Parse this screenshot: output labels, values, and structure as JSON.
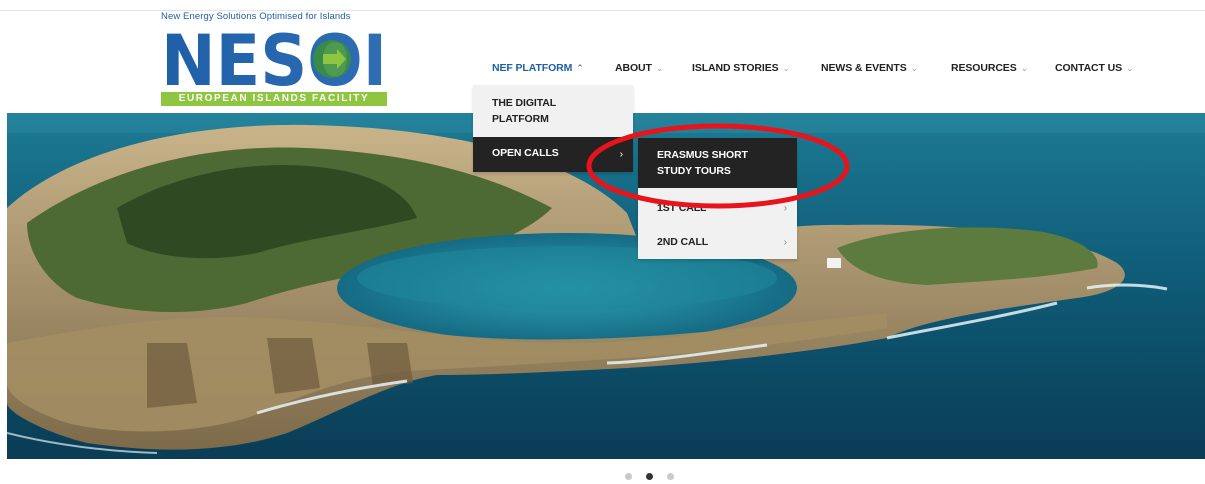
{
  "logo": {
    "tagline": "New Energy Solutions Optimised for Islands",
    "wordmark": "NESOI",
    "band": "EUROPEAN ISLANDS FACILITY",
    "colors": {
      "word": "#1e5fa8",
      "accent": "#3a8f3d",
      "band": "#8ec641"
    }
  },
  "nav": {
    "items": [
      {
        "label": "NEF PLATFORM",
        "active": true
      },
      {
        "label": "ABOUT"
      },
      {
        "label": "ISLAND STORIES"
      },
      {
        "label": "NEWS & EVENTS"
      },
      {
        "label": "RESOURCES"
      },
      {
        "label": "CONTACT US"
      }
    ],
    "caret_icon": "chevron-down-icon",
    "active_color": "#1e5fa8"
  },
  "dropdown": {
    "items": [
      {
        "label_line1": "THE DIGITAL",
        "label_line2": "PLATFORM"
      },
      {
        "label": "OPEN CALLS",
        "highlighted": true,
        "submenu_icon": "chevron-right-icon"
      }
    ]
  },
  "submenu": {
    "items": [
      {
        "label_line1": "ERASMUS SHORT",
        "label_line2": "STUDY TOURS",
        "highlighted": true
      },
      {
        "label": "1ST CALL",
        "submenu_icon": "chevron-right-icon"
      },
      {
        "label": "2ND CALL",
        "submenu_icon": "chevron-right-icon"
      }
    ]
  },
  "annotation": {
    "shape": "ellipse",
    "color": "#e8141b",
    "target": "ERASMUS SHORT STUDY TOURS"
  },
  "hero": {
    "subject": "aerial view of a horseshoe-shaped volcanic islet in the ocean"
  },
  "slider": {
    "dots": 3,
    "active_index": 1
  }
}
